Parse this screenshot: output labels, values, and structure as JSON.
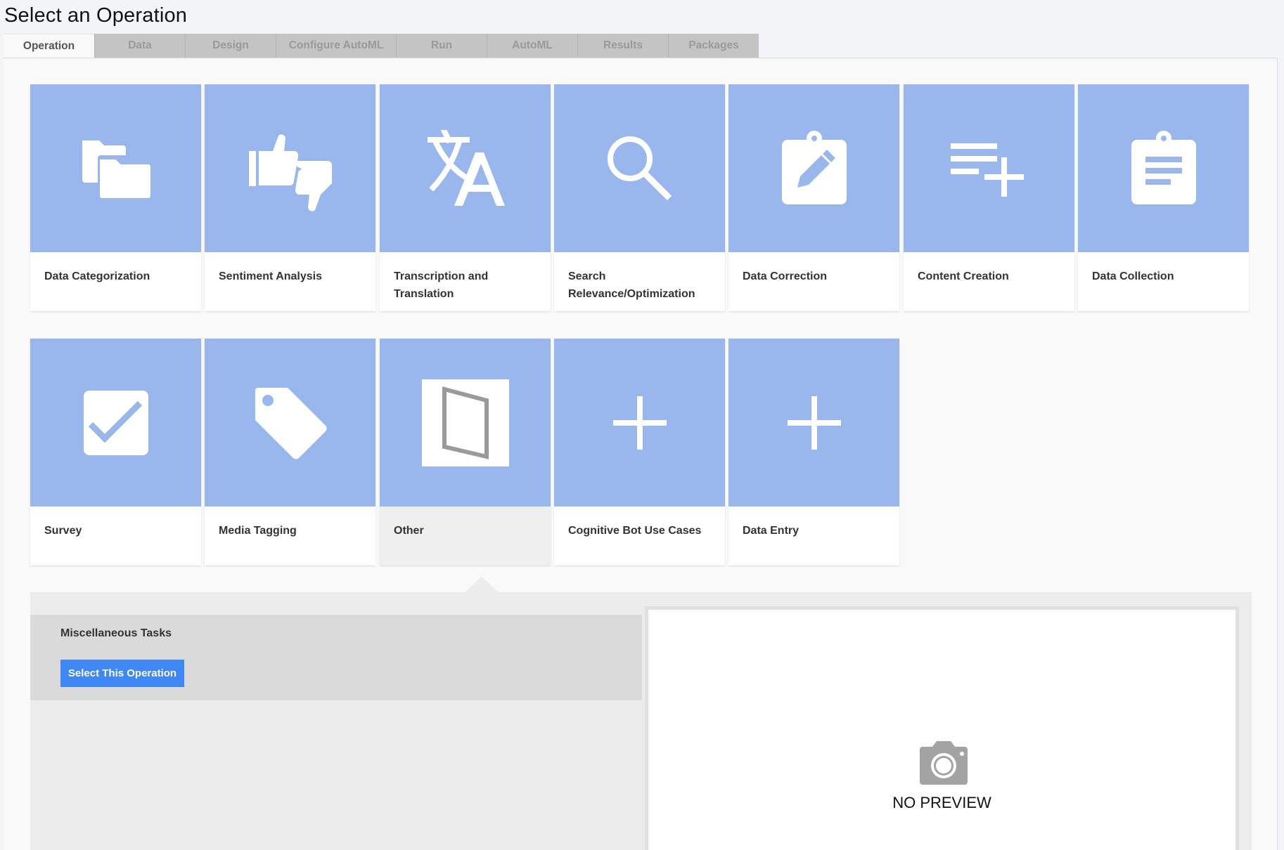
{
  "page": {
    "title": "Select an Operation"
  },
  "tabs": [
    {
      "label": "Operation",
      "active": true
    },
    {
      "label": "Data",
      "active": false
    },
    {
      "label": "Design",
      "active": false
    },
    {
      "label": "Configure AutoML",
      "active": false
    },
    {
      "label": "Run",
      "active": false
    },
    {
      "label": "AutoML",
      "active": false
    },
    {
      "label": "Results",
      "active": false
    },
    {
      "label": "Packages",
      "active": false
    }
  ],
  "operations": [
    {
      "label": "Data Categorization",
      "icon": "folders-icon"
    },
    {
      "label": "Sentiment Analysis",
      "icon": "thumbs-up-down-icon"
    },
    {
      "label": "Transcription and Translation",
      "icon": "translate-icon"
    },
    {
      "label": "Search Relevance/Optimization",
      "icon": "search-icon"
    },
    {
      "label": "Data Correction",
      "icon": "clipboard-edit-icon"
    },
    {
      "label": "Content Creation",
      "icon": "playlist-add-icon"
    },
    {
      "label": "Data Collection",
      "icon": "clipboard-list-icon"
    },
    {
      "label": "Survey",
      "icon": "checkbox-icon"
    },
    {
      "label": "Media Tagging",
      "icon": "tag-icon"
    },
    {
      "label": "Other",
      "icon": "image-placeholder-icon",
      "selected": true
    },
    {
      "label": "Cognitive Bot Use Cases",
      "icon": "plus-icon"
    },
    {
      "label": "Data Entry",
      "icon": "plus-icon"
    }
  ],
  "detail": {
    "name": "Miscellaneous Tasks",
    "select_button": "Select This Operation",
    "preview_text": "NO PREVIEW",
    "preview_icon": "camera-icon"
  },
  "colors": {
    "tile": "#99b7ed",
    "button": "#3f87f5",
    "tab_inactive": "#c4c4c4"
  }
}
